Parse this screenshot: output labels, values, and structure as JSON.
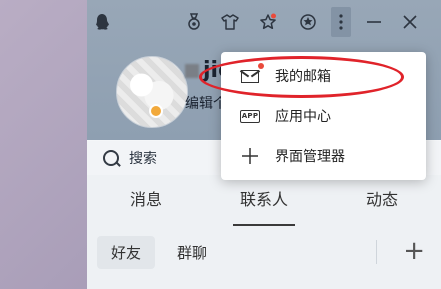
{
  "profile": {
    "nickname_visible": "jic",
    "signature_visible": "编辑个"
  },
  "search": {
    "placeholder": "搜索"
  },
  "tabs": [
    {
      "label": "消息"
    },
    {
      "label": "联系人"
    },
    {
      "label": "动态"
    }
  ],
  "subtabs": [
    {
      "label": "好友"
    },
    {
      "label": "群聊"
    }
  ],
  "add_label": "+",
  "dropdown_menu": {
    "items": [
      {
        "label": "我的邮箱",
        "icon": "mail-icon",
        "has_notification_dot": true
      },
      {
        "label": "应用中心",
        "icon": "app-icon",
        "icon_text": "APP"
      },
      {
        "label": "界面管理器",
        "icon": "plus-icon"
      }
    ]
  },
  "colors": {
    "header_bg": "#98a7b7",
    "highlight_red": "#e0232a",
    "notification_dot": "#e94a3b",
    "avatar_badge": "#f2a93b"
  }
}
